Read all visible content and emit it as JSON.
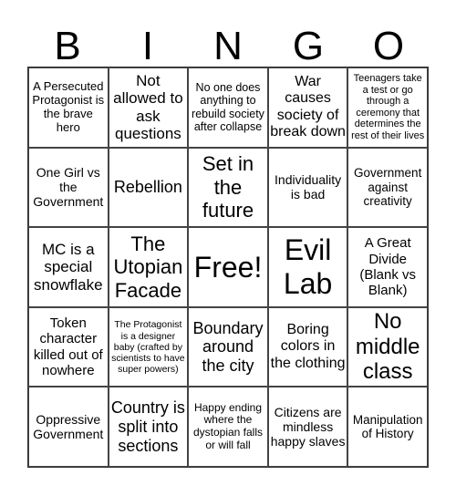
{
  "title_letters": [
    "B",
    "I",
    "N",
    "G",
    "O"
  ],
  "cells": [
    "A Persecuted Protagonist is the brave hero",
    "Not allowed to ask questions",
    "No one does anything to rebuild society after collapse",
    "War causes society of break down",
    "Teenagers take a test or go through a ceremony that determines the rest of their lives",
    "One Girl vs the Government",
    "Rebellion",
    "Set in the future",
    "Individuality is bad",
    "Government against creativity",
    "MC is a special snowflake",
    "The Utopian Facade",
    "Free!",
    "Evil Lab",
    "A Great Divide (Blank vs Blank)",
    "Token character killed out of nowhere",
    "The Protagonist is a designer baby (crafted by scientists to have super powers)",
    "Boundary around the city",
    "Boring colors in the clothing",
    "No middle class",
    "Oppressive Government",
    "Country is split into sections",
    "Happy ending where the dystopian falls or will fall",
    "Citizens are mindless happy slaves",
    "Manipulation of History"
  ]
}
